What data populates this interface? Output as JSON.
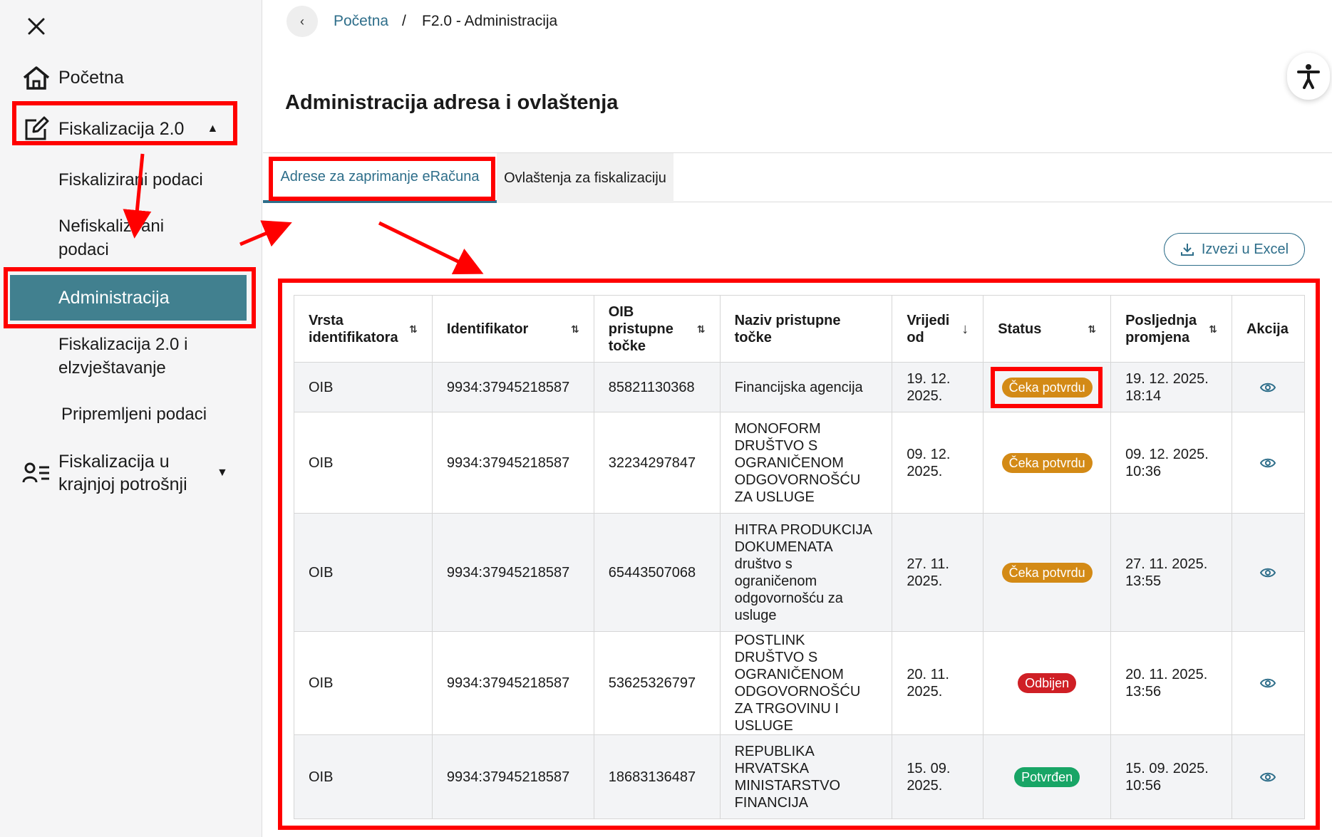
{
  "sidebar": {
    "home_label": "Početna",
    "fiscal_label": "Fiskalizacija 2.0",
    "sub_items": [
      "Fiskalizirani podaci",
      "Nefiskalizirani podaci",
      "Administracija",
      "Fiskalizacija 2.0 i elzvještavanje",
      "Pripremljeni podaci"
    ],
    "consumption_label": "Fiskalizacija u krajnjoj potrošnji"
  },
  "breadcrumb": {
    "home": "Početna",
    "separator": "/",
    "current": "F2.0 - Administracija"
  },
  "page_title": "Administracija adresa i ovlaštenja",
  "tabs": [
    "Adrese za zaprimanje eRačuna",
    "Ovlaštenja za fiskalizaciju"
  ],
  "export_label": "Izvezi u Excel",
  "table": {
    "headers": [
      "Vrsta identifikatora",
      "Identifikator",
      "OIB pristupne točke",
      "Naziv pristupne točke",
      "Vrijedi od",
      "Status",
      "Posljednja promjena",
      "Akcija"
    ],
    "rows": [
      {
        "vrsta": "OIB",
        "identifikator": "9934:37945218587",
        "oib": "85821130368",
        "naziv": "Financijska agencija",
        "vrijedi": "19. 12. 2025.",
        "status": "Čeka potvrdu",
        "promjena": "19. 12. 2025. 18:14"
      },
      {
        "vrsta": "OIB",
        "identifikator": "9934:37945218587",
        "oib": "32234297847",
        "naziv": "MONOFORM DRUŠTVO S OGRANIČENOM ODGOVORNOŠĆU ZA USLUGE",
        "vrijedi": "09. 12. 2025.",
        "status": "Čeka potvrdu",
        "promjena": "09. 12. 2025. 10:36"
      },
      {
        "vrsta": "OIB",
        "identifikator": "9934:37945218587",
        "oib": "65443507068",
        "naziv": "HITRA PRODUKCIJA DOKUMENATA društvo s ograničenom odgovornošću za usluge",
        "vrijedi": "27. 11. 2025.",
        "status": "Čeka potvrdu",
        "promjena": "27. 11. 2025. 13:55"
      },
      {
        "vrsta": "OIB",
        "identifikator": "9934:37945218587",
        "oib": "53625326797",
        "naziv": "POSTLINK DRUŠTVO S OGRANIČENOM ODGOVORNOŠĆU ZA TRGOVINU I USLUGE",
        "vrijedi": "20. 11. 2025.",
        "status": "Odbijen",
        "promjena": "20. 11. 2025. 13:56"
      },
      {
        "vrsta": "OIB",
        "identifikator": "9934:37945218587",
        "oib": "18683136487",
        "naziv": "REPUBLIKA HRVATSKA MINISTARSTVO FINANCIJA",
        "vrijedi": "15. 09. 2025.",
        "status": "Potvrđen",
        "promjena": "15. 09. 2025. 10:56"
      }
    ]
  },
  "colors": {
    "accent": "#41808f",
    "link": "#2e6e8a",
    "status_pending": "#d38a16",
    "status_rejected": "#cf1f25",
    "status_confirmed": "#18a566",
    "annotation": "#ff0000"
  },
  "icons": [
    "close-icon",
    "home-icon",
    "edit-icon",
    "caret-up-icon",
    "users-list-icon",
    "caret-down-icon",
    "chevron-left-icon",
    "accessibility-icon",
    "download-icon",
    "sort-icon",
    "arrow-down-icon",
    "eye-icon"
  ]
}
